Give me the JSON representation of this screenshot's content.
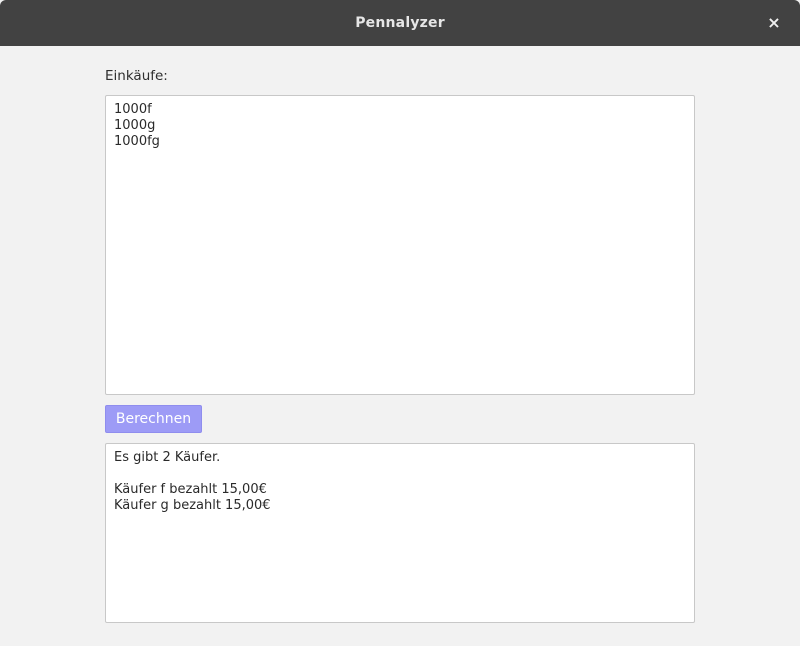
{
  "window": {
    "title": "Pennalyzer",
    "close_glyph": "×"
  },
  "form": {
    "input_label": "Einkäufe:",
    "input_value": "1000f\n1000g\n1000fg",
    "button_label": "Berechnen",
    "output_value": "Es gibt 2 Käufer.\n\nKäufer f bezahlt 15,00€\nKäufer g bezahlt 15,00€"
  },
  "colors": {
    "titlebar": "#424242",
    "background": "#f2f2f2",
    "button": "#9d9bf6"
  }
}
